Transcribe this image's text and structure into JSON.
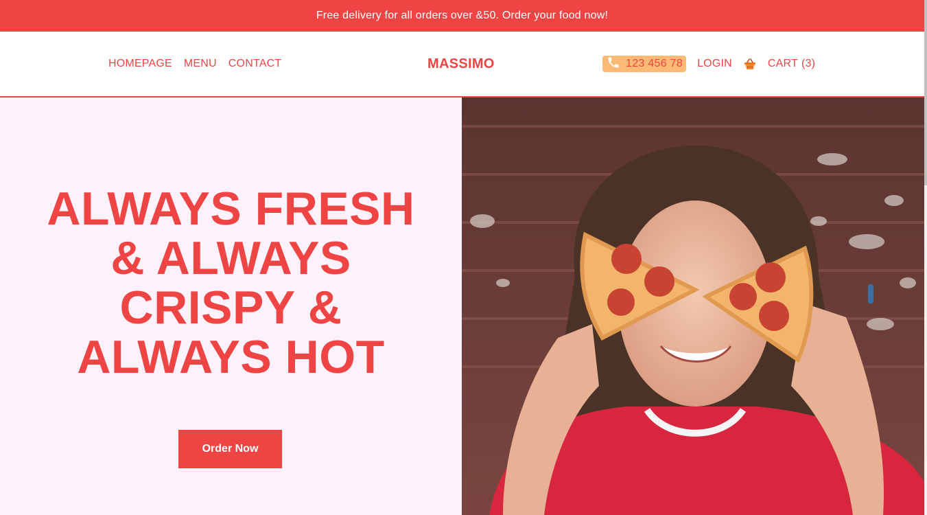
{
  "promo": {
    "text": "Free delivery for all orders over &50. Order your food now!"
  },
  "nav": {
    "links": [
      "HOMEPAGE",
      "MENU",
      "CONTACT"
    ],
    "logo": "MASSIMO",
    "phone": "123 456 78",
    "login": "LOGIN",
    "cart_label": "CART",
    "cart_count": "(3)"
  },
  "hero": {
    "title_lines": [
      "ALWAYS FRESH",
      "& ALWAYS",
      "CRISPY &",
      "ALWAYS HOT"
    ],
    "cta": "Order Now"
  },
  "icons": {
    "phone": "phone-icon",
    "cart": "basket-icon"
  },
  "colors": {
    "accent": "#ef4444",
    "hero_bg": "#fdf2fb",
    "phone_pill": "#fdba74",
    "white": "#ffffff"
  }
}
